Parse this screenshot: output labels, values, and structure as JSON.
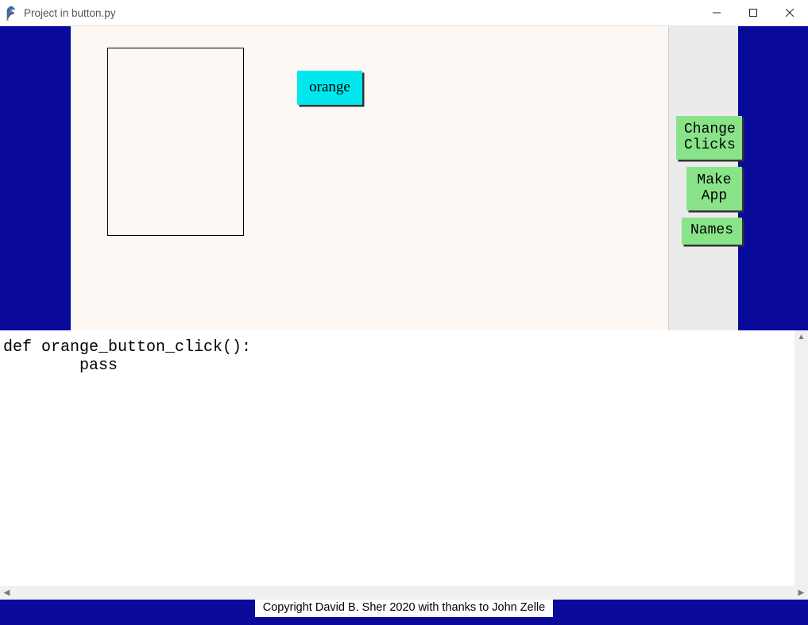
{
  "window": {
    "title": "Project in button.py"
  },
  "canvas": {
    "buttons": {
      "orange_label": "orange"
    }
  },
  "sidebar": {
    "change_clicks_label": "Change\nClicks",
    "make_app_label": "Make\nApp",
    "names_label": "Names"
  },
  "code": {
    "text": "def orange_button_click():\n        pass"
  },
  "footer": {
    "copyright": "Copyright David B. Sher 2020 with thanks to John Zelle"
  },
  "colors": {
    "frame_blue": "#0a0a9a",
    "canvas_bg": "#fdf8f3",
    "sidebar_bg": "#ebebeb",
    "button_cyan": "#00e8ee",
    "button_green": "#89e489"
  }
}
